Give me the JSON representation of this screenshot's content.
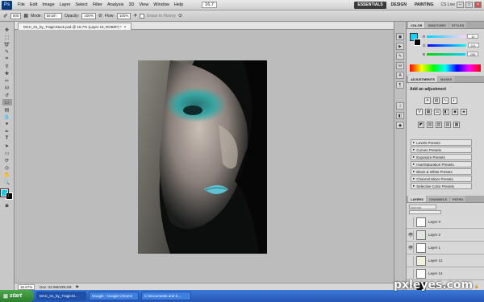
{
  "menu": {
    "items": [
      "File",
      "Edit",
      "Image",
      "Layer",
      "Select",
      "Filter",
      "Analysis",
      "3D",
      "View",
      "Window",
      "Help"
    ],
    "zoom_value": "16.7",
    "workspaces": [
      "ESSENTIALS",
      "DESIGN",
      "PAINTING"
    ],
    "cs_live": "CS Live"
  },
  "options": {
    "mode_label": "Mode:",
    "mode_value": "Brush",
    "opacity_label": "Opacity:",
    "opacity_value": "100%",
    "flow_label": "Flow:",
    "flow_value": "100%",
    "erase_label": "Erase to History",
    "brush_size": "500"
  },
  "document": {
    "tab_title": "MAC_01_by_TragicStock.psd @ 16.7% (Layer 15, RGB/8*) *",
    "zoom": "16.67%",
    "doc_size": "Doc: 22.9M/339.2M"
  },
  "color_panel": {
    "tabs": [
      "COLOR",
      "SWATCHES",
      "STYLES"
    ],
    "values": [
      "10",
      "211",
      "255"
    ],
    "fg_color": "#0ad3ff"
  },
  "adjustments": {
    "tabs": [
      "ADJUSTMENTS",
      "MASKS"
    ],
    "title": "Add an adjustment",
    "presets": [
      "Levels Presets",
      "Curves Presets",
      "Exposure Presets",
      "Hue/Saturation Presets",
      "Black & White Presets",
      "Channel Mixer Presets",
      "Selective Color Presets"
    ]
  },
  "layers": {
    "tabs": [
      "LAYERS",
      "CHANNELS",
      "PATHS"
    ],
    "blend_mode": "Normal",
    "list": [
      {
        "name": "Layer 3",
        "visible": false
      },
      {
        "name": "Layer 2",
        "visible": true
      },
      {
        "name": "Layer 1",
        "visible": true
      },
      {
        "name": "Layer 12",
        "visible": false
      },
      {
        "name": "Layer 14",
        "visible": false
      },
      {
        "name": "Background",
        "visible": true
      }
    ]
  },
  "taskbar": {
    "start": "start",
    "tasks": [
      "MAC_01_by_TragicSt...",
      "Google - Google Chrome",
      "C:\\Documents and S..."
    ]
  },
  "watermark": "pxleyes.com"
}
